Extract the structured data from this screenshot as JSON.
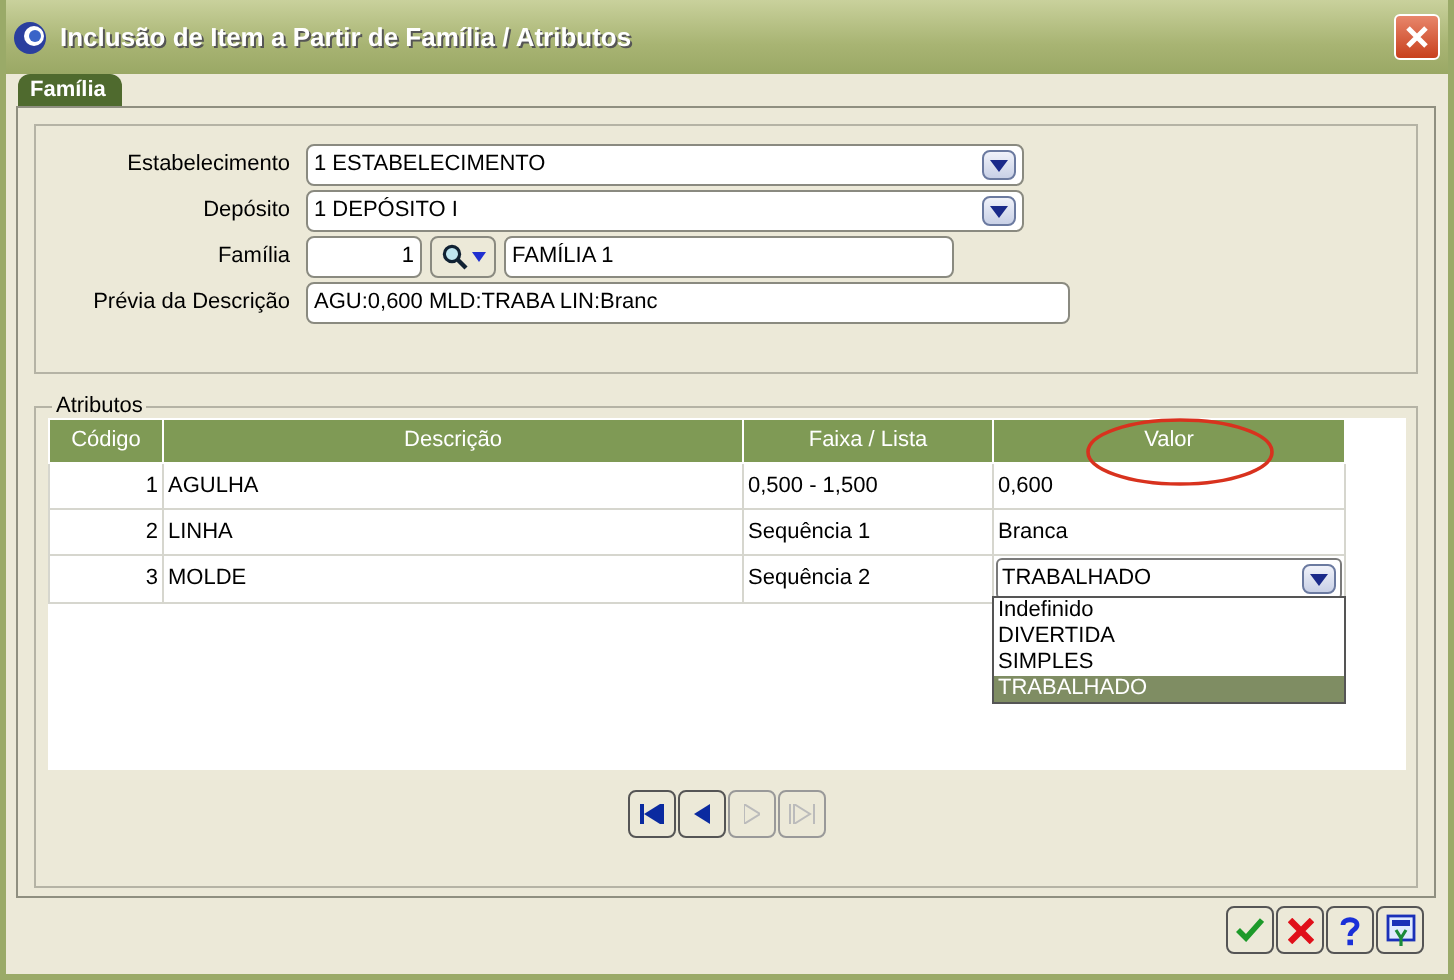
{
  "window": {
    "title": "Inclusão de Item a Partir de Família / Atributos"
  },
  "tabs": [
    {
      "label": "Família",
      "selected": true
    }
  ],
  "form": {
    "fields": [
      {
        "kind": "select",
        "label": "Estabelecimento",
        "value": "1 ESTABELECIMENTO"
      },
      {
        "kind": "select",
        "label": "Depósito",
        "value": "1 DEPÓSITO I"
      },
      {
        "kind": "lookup",
        "label": "Família",
        "code": "1",
        "value": "FAMÍLIA 1"
      },
      {
        "kind": "text",
        "label": "Prévia da Descrição",
        "value": "AGU:0,600 MLD:TRABA  LIN:Branc"
      }
    ]
  },
  "attributes": {
    "title": "Atributos",
    "columns": [
      "Código",
      "Descrição",
      "Faixa / Lista",
      "Valor"
    ],
    "rows": [
      {
        "code": "1",
        "description": "AGULHA",
        "range": "0,500 - 1,500",
        "value": "0,600",
        "editing": false
      },
      {
        "code": "2",
        "description": "LINHA",
        "range": "Sequência 1",
        "value": "Branca",
        "editing": false
      },
      {
        "code": "3",
        "description": "MOLDE",
        "range": "Sequência 2",
        "value": "TRABALHADO",
        "editing": true
      }
    ],
    "dropdown_options": [
      {
        "label": "Indefinido",
        "selected": false
      },
      {
        "label": "DIVERTIDA",
        "selected": false
      },
      {
        "label": "SIMPLES",
        "selected": false
      },
      {
        "label": "TRABALHADO",
        "selected": true
      }
    ]
  },
  "navigation": [
    {
      "kind": "first",
      "disabled": false
    },
    {
      "kind": "previous",
      "disabled": false
    },
    {
      "kind": "next",
      "disabled": true
    },
    {
      "kind": "last",
      "disabled": true
    }
  ],
  "actions": [
    {
      "kind": "ok"
    },
    {
      "kind": "cancel"
    },
    {
      "kind": "help"
    },
    {
      "kind": "settings"
    }
  ]
}
